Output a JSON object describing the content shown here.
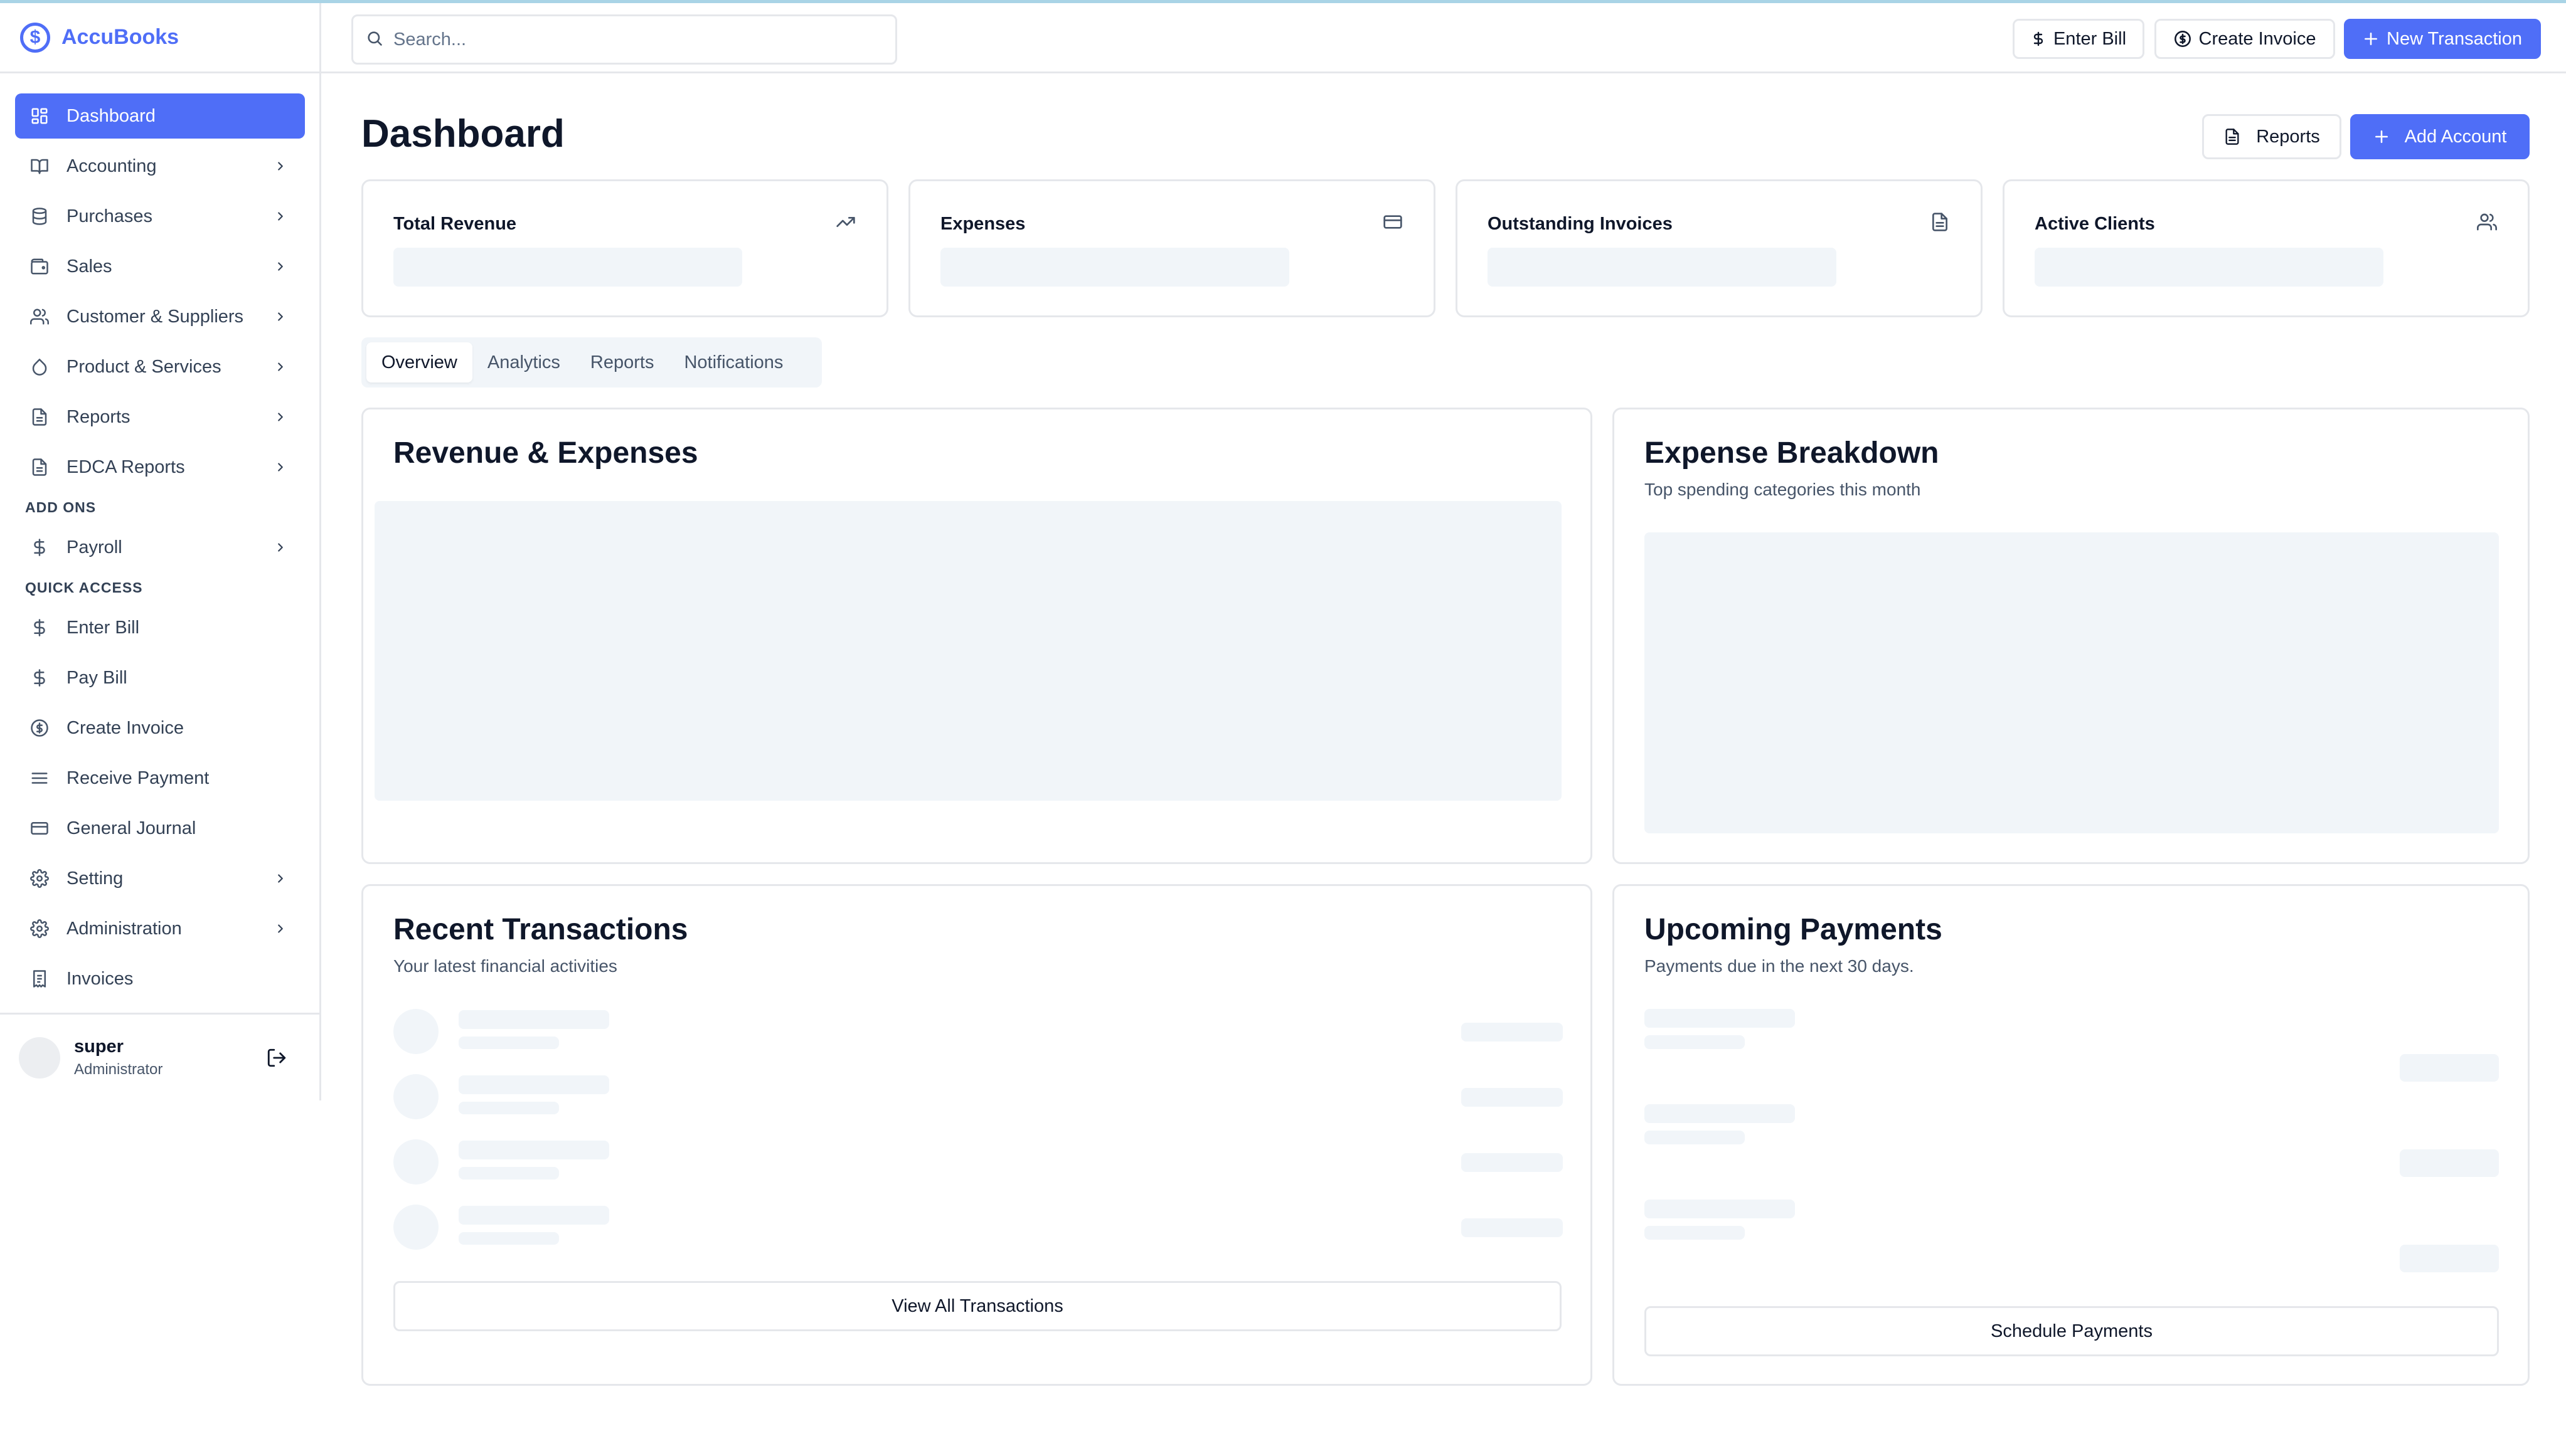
{
  "app": {
    "name": "AccuBooks",
    "logo_glyph": "$"
  },
  "sidebar": {
    "items": [
      {
        "label": "Dashboard",
        "icon": "grid-icon",
        "active": true,
        "chevron": false
      },
      {
        "label": "Accounting",
        "icon": "book-icon",
        "chevron": true
      },
      {
        "label": "Purchases",
        "icon": "database-icon",
        "chevron": true
      },
      {
        "label": "Sales",
        "icon": "wallet-icon",
        "chevron": true
      },
      {
        "label": "Customer & Suppliers",
        "icon": "users-icon",
        "chevron": true
      },
      {
        "label": "Product & Services",
        "icon": "droplet-icon",
        "chevron": true
      },
      {
        "label": "Reports",
        "icon": "file-icon",
        "chevron": true
      },
      {
        "label": "EDCA Reports",
        "icon": "file-icon",
        "chevron": true
      }
    ],
    "addons_label": "ADD ONS",
    "addons": [
      {
        "label": "Payroll",
        "icon": "dollar-icon",
        "chevron": true
      }
    ],
    "quick_access_label": "QUICK ACCESS",
    "quick": [
      {
        "label": "Enter Bill",
        "icon": "dollar-icon",
        "chevron": false
      },
      {
        "label": "Pay Bill",
        "icon": "dollar-icon",
        "chevron": false
      },
      {
        "label": "Create Invoice",
        "icon": "coin-icon",
        "chevron": false
      },
      {
        "label": "Receive Payment",
        "icon": "menu-icon",
        "chevron": false
      },
      {
        "label": "General Journal",
        "icon": "card-icon",
        "chevron": false
      },
      {
        "label": "Setting",
        "icon": "gear-icon",
        "chevron": true
      },
      {
        "label": "Administration",
        "icon": "gear-icon",
        "chevron": true
      },
      {
        "label": "Invoices",
        "icon": "receipt-icon",
        "chevron": false
      }
    ]
  },
  "user": {
    "name": "super",
    "role": "Administrator"
  },
  "header": {
    "search_placeholder": "Search...",
    "enter_bill": "Enter Bill",
    "create_invoice": "Create Invoice",
    "new_transaction": "New Transaction"
  },
  "main": {
    "title": "Dashboard",
    "reports_button": "Reports",
    "add_account_button": "Add Account",
    "stats": [
      {
        "title": "Total Revenue",
        "icon": "trending-up-icon"
      },
      {
        "title": "Expenses",
        "icon": "credit-card-icon"
      },
      {
        "title": "Outstanding Invoices",
        "icon": "file-icon"
      },
      {
        "title": "Active Clients",
        "icon": "users-icon"
      }
    ],
    "tabs": [
      "Overview",
      "Analytics",
      "Reports",
      "Notifications"
    ],
    "active_tab": "Overview",
    "revenue_card": {
      "title": "Revenue & Expenses"
    },
    "expense_card": {
      "title": "Expense Breakdown",
      "subtitle": "Top spending categories this month"
    },
    "transactions_card": {
      "title": "Recent Transactions",
      "subtitle": "Your latest financial activities",
      "button": "View All Transactions"
    },
    "payments_card": {
      "title": "Upcoming Payments",
      "subtitle": "Payments due in the next 30 days.",
      "button": "Schedule Payments"
    }
  },
  "colors": {
    "accent": "#4f6ef7",
    "border": "#e5e7eb",
    "placeholder": "#f1f5f9"
  }
}
